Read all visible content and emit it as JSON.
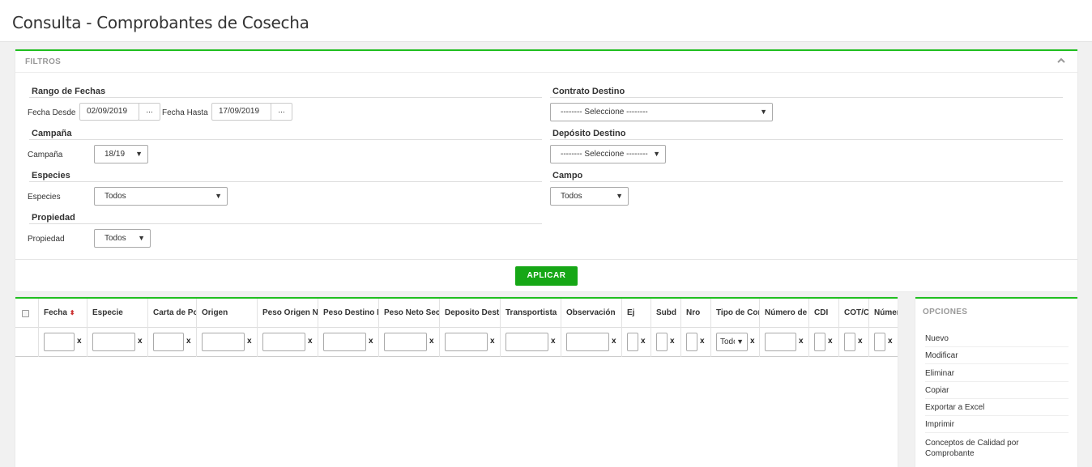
{
  "page": {
    "title": "Consulta - Comprobantes de Cosecha"
  },
  "filters": {
    "heading": "FILTROS",
    "rango_fechas": {
      "title": "Rango de Fechas",
      "desde_label": "Fecha Desde",
      "desde_value": "02/09/2019",
      "hasta_label": "Fecha Hasta",
      "hasta_value": "17/09/2019",
      "picker_label": "..."
    },
    "campana": {
      "title": "Campaña",
      "label": "Campaña",
      "value": "18/19"
    },
    "especies": {
      "title": "Especies",
      "label": "Especies",
      "value": "Todos"
    },
    "propiedad": {
      "title": "Propiedad",
      "label": "Propiedad",
      "value": "Todos"
    },
    "contrato_destino": {
      "title": "Contrato Destino",
      "value": "-------- Seleccione --------"
    },
    "deposito_destino": {
      "title": "Depósito Destino",
      "value": "-------- Seleccione --------"
    },
    "campo": {
      "title": "Campo",
      "value": "Todos"
    },
    "apply_label": "APLICAR"
  },
  "grid": {
    "columns": [
      "Fecha",
      "Especie",
      "Carta de Porte",
      "Origen",
      "Peso Origen Neto",
      "Peso Destino Neto",
      "Peso Neto Seco",
      "Deposito Destino",
      "Transportista",
      "Observación",
      "Ej",
      "Subd",
      "Nro",
      "Tipo de Comprobante",
      "Número de",
      "CDI",
      "COT/C",
      "Número"
    ],
    "filter_clear": "x",
    "tipo_filter_value": "Todos"
  },
  "options": {
    "heading": "OPCIONES",
    "items": [
      "Nuevo",
      "Modificar",
      "Eliminar",
      "Copiar",
      "Exportar a Excel",
      "Imprimir",
      "Conceptos de Calidad por Comprobante"
    ]
  }
}
